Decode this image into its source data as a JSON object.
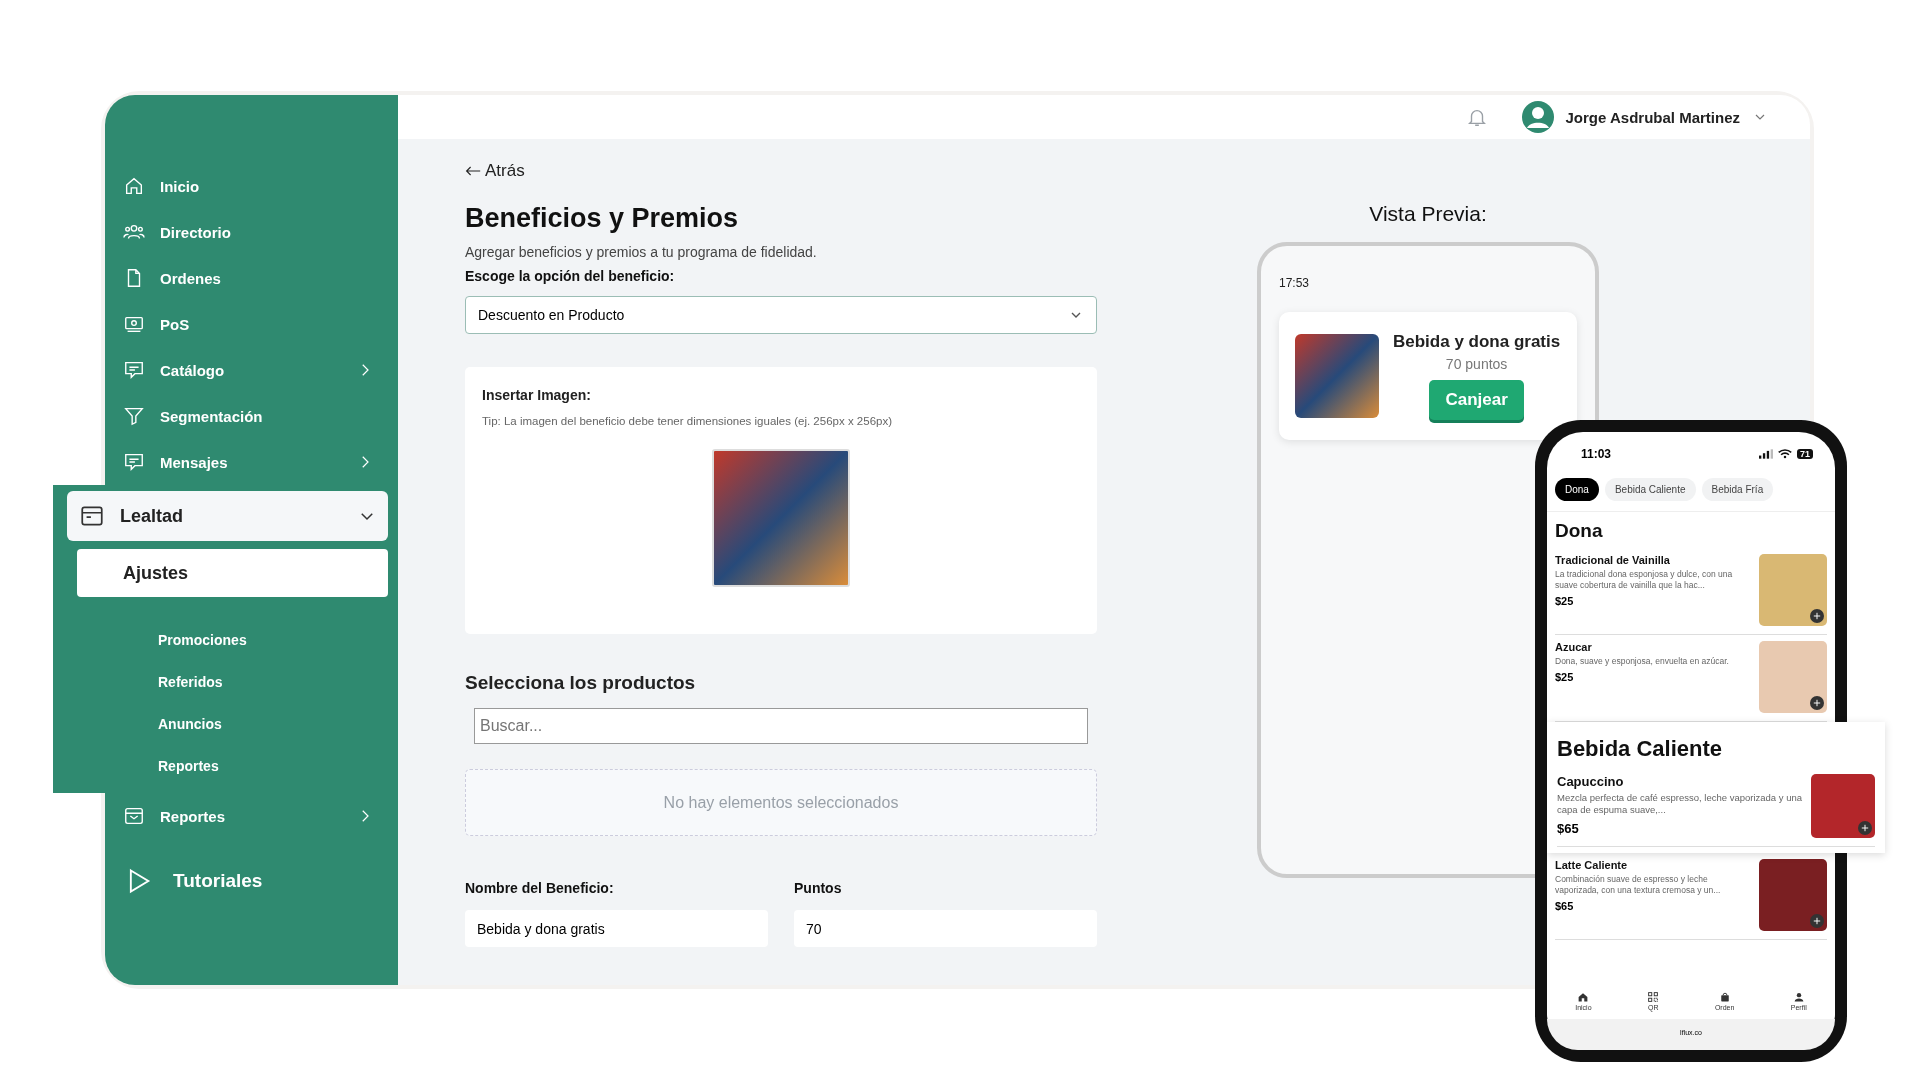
{
  "sidebar": {
    "items": [
      {
        "label": "Inicio",
        "expandable": false
      },
      {
        "label": "Directorio",
        "expandable": false
      },
      {
        "label": "Ordenes",
        "expandable": false
      },
      {
        "label": "PoS",
        "expandable": false
      },
      {
        "label": "Catálogo",
        "expandable": true
      },
      {
        "label": "Segmentación",
        "expandable": false
      },
      {
        "label": "Mensajes",
        "expandable": true
      },
      {
        "label": "Lealtad",
        "expandable": true,
        "expanded": true,
        "children": [
          {
            "label": "Ajustes",
            "selected": true
          },
          {
            "label": "Promociones",
            "selected": false
          },
          {
            "label": "Referidos",
            "selected": false
          },
          {
            "label": "Anuncios",
            "selected": false
          },
          {
            "label": "Reportes",
            "selected": false
          }
        ]
      },
      {
        "label": "Reportes",
        "expandable": true
      }
    ],
    "tutorials": "Tutoriales"
  },
  "topbar": {
    "user_name": "Jorge Asdrubal Martinez"
  },
  "form": {
    "back": "Atrás",
    "title": "Beneficios y Premios",
    "subtitle": "Agregar beneficios y premios a tu programa de fidelidad.",
    "option_label": "Escoge la opción del beneficio:",
    "option_value": "Descuento en Producto",
    "image_label": "Insertar Imagen:",
    "image_tip": "Tip: La imagen del beneficio debe tener dimensiones iguales (ej. 256px x 256px)",
    "products_title": "Selecciona los productos",
    "search": {
      "placeholder": "Buscar..."
    },
    "empty": "No hay elementos seleccionados",
    "name_label": "Nombre del Beneficio:",
    "name_value": "Bebida y dona gratis",
    "points_label": "Puntos",
    "points_value": "70"
  },
  "preview": {
    "title": "Vista Previa:",
    "time": "17:53",
    "card_title": "Bebida y dona gratis",
    "card_points": "70 puntos",
    "button": "Canjear"
  },
  "phone": {
    "time": "11:03",
    "battery": "71",
    "tabs": [
      {
        "label": "Dona",
        "selected": true
      },
      {
        "label": "Bebida Caliente",
        "selected": false
      },
      {
        "label": "Bebida Fría",
        "selected": false
      }
    ],
    "sections": [
      {
        "title": "Dona",
        "highlighted": false,
        "items": [
          {
            "name": "Tradicional de Vainilla",
            "description": "La tradicional dona esponjosa y dulce, con una suave cobertura de vainilla que la hac...",
            "price": "$25",
            "color": "#d9b873"
          },
          {
            "name": "Azucar",
            "description": "Dona, suave y esponjosa, envuelta en azúcar.",
            "price": "$25",
            "color": "#e8c9b0"
          }
        ]
      },
      {
        "title": "Bebida Caliente",
        "highlighted": true,
        "items": [
          {
            "name": "Capuccino",
            "description": "Mezcla perfecta de café espresso, leche vaporizada y una capa de espuma suave,...",
            "price": "$65",
            "color": "#b3262a"
          }
        ]
      },
      {
        "highlighted": false,
        "items": [
          {
            "name": "Latte Caliente",
            "description": "Combinación suave de espresso y leche vaporizada, con una textura cremosa y un...",
            "price": "$65",
            "color": "#7a1f22"
          }
        ]
      }
    ],
    "nav": [
      "Inicio",
      "QR",
      "Orden",
      "Perfil"
    ],
    "footer": "lflux.co"
  }
}
